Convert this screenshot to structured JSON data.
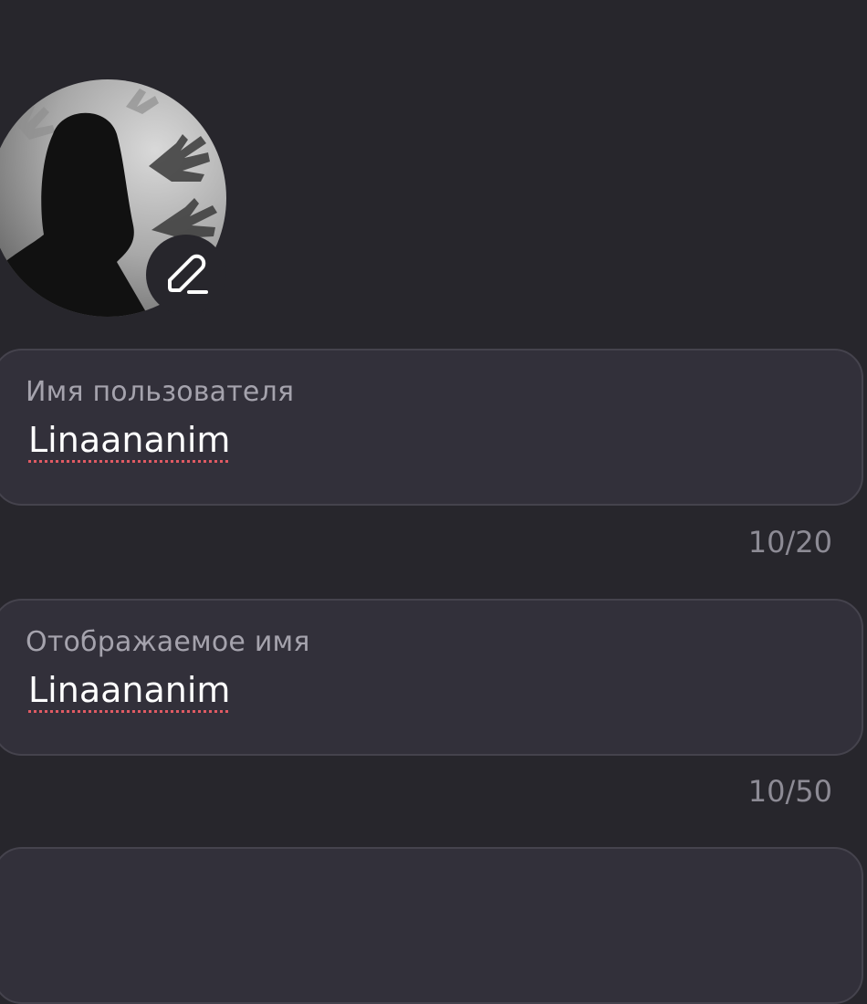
{
  "profile": {
    "avatar_icon": "profile-photo",
    "edit_icon": "pencil-icon"
  },
  "fields": [
    {
      "label": "Имя пользователя",
      "value": "Linaananim",
      "counter": "10/20"
    },
    {
      "label": "Отображаемое имя",
      "value": "Linaananim",
      "counter": "10/50"
    }
  ],
  "colors": {
    "background": "#27262c",
    "field_background": "#32303a",
    "field_border": "#45434d",
    "label": "#a5a3ad",
    "counter": "#8d8b95",
    "spellcheck_underline": "#e05a63"
  }
}
